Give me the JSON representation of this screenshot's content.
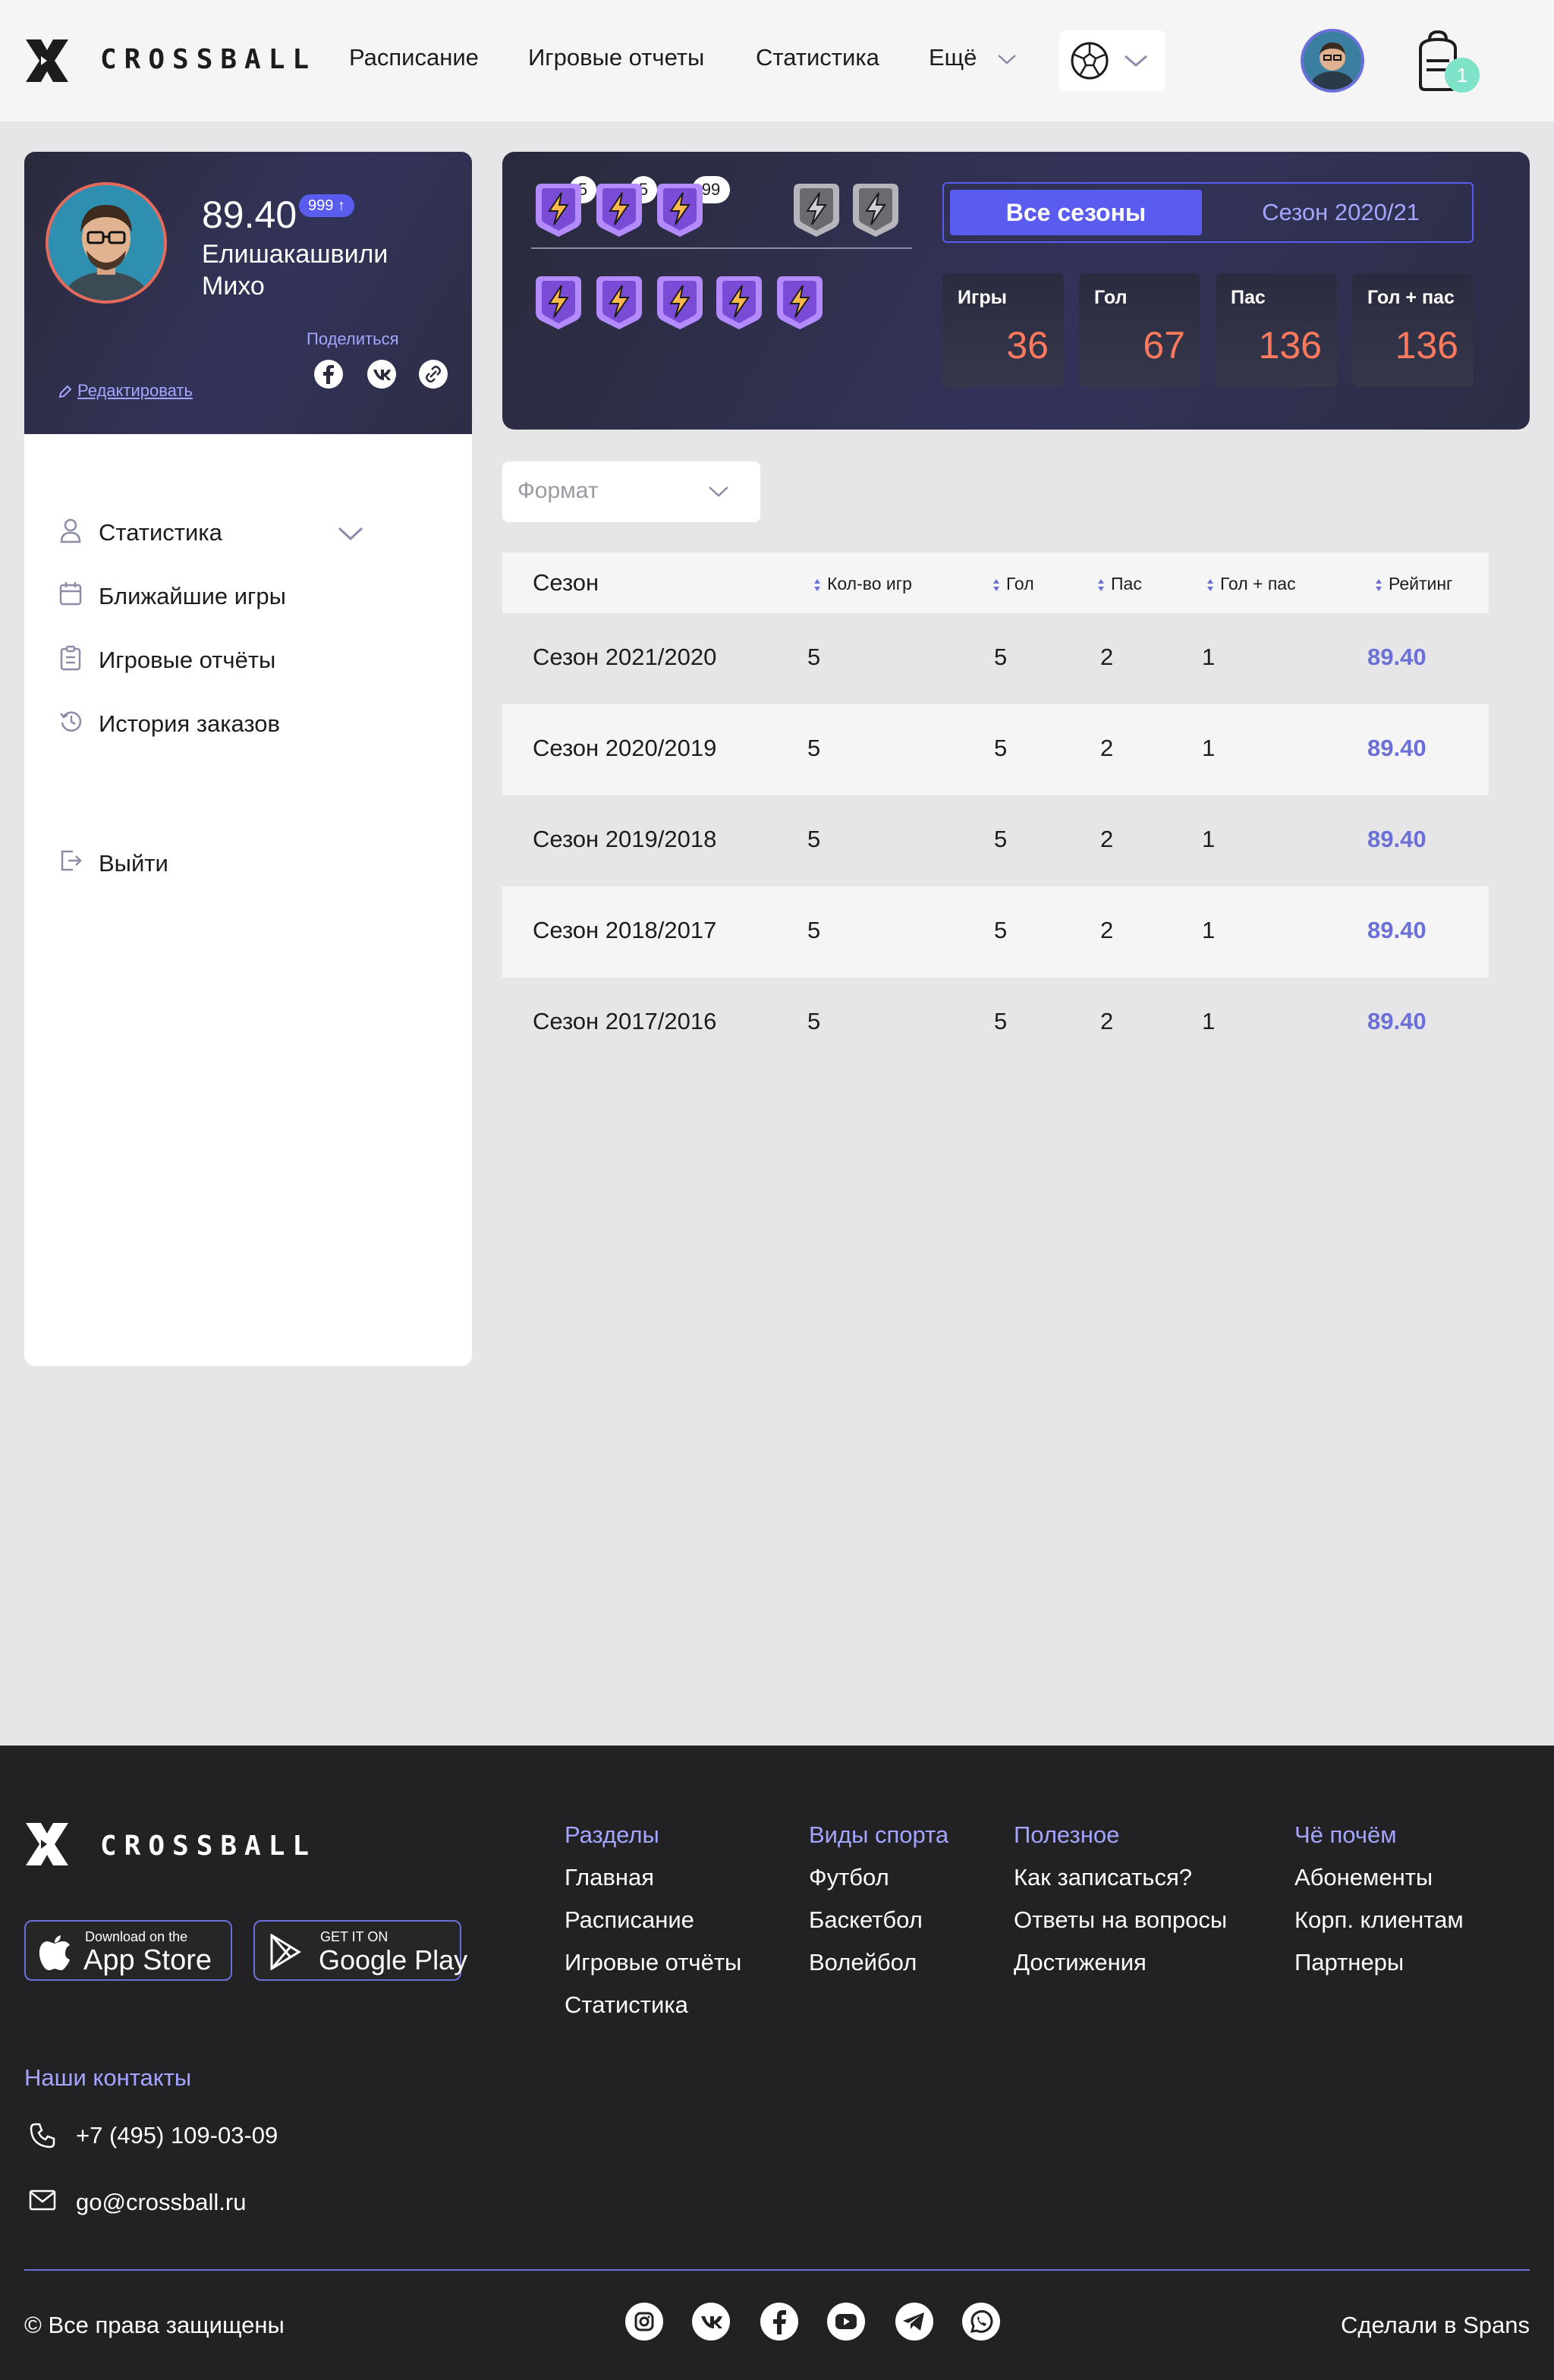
{
  "brand": {
    "name": "CROSSBALL"
  },
  "header": {
    "nav": [
      "Расписание",
      "Игровые отчеты",
      "Статистика",
      "Ещё"
    ],
    "cart_count": "1",
    "sport_icon": "soccer-ball-icon"
  },
  "profile": {
    "rating": "89.40",
    "rating_badge": "999 ↑",
    "name": "Елишакашвили Михо",
    "share_label": "Поделиться",
    "edit_label": "Редактировать"
  },
  "sidebar": {
    "items": [
      {
        "label": "Статистика",
        "icon": "user-icon"
      },
      {
        "label": "Ближайшие игры",
        "icon": "calendar-icon"
      },
      {
        "label": "Игровые отчёты",
        "icon": "clipboard-icon"
      },
      {
        "label": "История заказов",
        "icon": "history-icon"
      }
    ],
    "logout": "Выйти"
  },
  "achievements": {
    "top_counts": [
      "5",
      "5",
      "99"
    ]
  },
  "season_toggle": {
    "all": "Все сезоны",
    "current": "Сезон 2020/21"
  },
  "stats": [
    {
      "label": "Игры",
      "value": "36"
    },
    {
      "label": "Гол",
      "value": "67"
    },
    {
      "label": "Пас",
      "value": "136"
    },
    {
      "label": "Гол + пас",
      "value": "136"
    }
  ],
  "format_placeholder": "Формат",
  "table": {
    "headers": [
      "Сезон",
      "Кол-во игр",
      "Гол",
      "Пас",
      "Гол + пас",
      "Рейтинг"
    ],
    "rows": [
      [
        "Сезон 2021/2020",
        "5",
        "5",
        "2",
        "1",
        "89.40"
      ],
      [
        "Сезон 2020/2019",
        "5",
        "5",
        "2",
        "1",
        "89.40"
      ],
      [
        "Сезон 2019/2018",
        "5",
        "5",
        "2",
        "1",
        "89.40"
      ],
      [
        "Сезон 2018/2017",
        "5",
        "5",
        "2",
        "1",
        "89.40"
      ],
      [
        "Сезон 2017/2016",
        "5",
        "5",
        "2",
        "1",
        "89.40"
      ]
    ]
  },
  "footer": {
    "app_store": {
      "small": "Download on the",
      "big": "App Store"
    },
    "google_play": {
      "small": "GET IT ON",
      "big": "Google Play"
    },
    "columns": [
      {
        "title": "Разделы",
        "links": [
          "Главная",
          "Расписание",
          "Игровые отчёты",
          "Статистика"
        ]
      },
      {
        "title": "Виды спорта",
        "links": [
          "Футбол",
          "Баскетбол",
          "Волейбол"
        ]
      },
      {
        "title": "Полезное",
        "links": [
          "Как записаться?",
          "Ответы на вопросы",
          "Достижения"
        ]
      },
      {
        "title": "Чё почём",
        "links": [
          "Абонементы",
          "Корп. клиентам",
          "Партнеры"
        ]
      }
    ],
    "contacts_title": "Наши контакты",
    "phone": "+7 (495) 109-03-09",
    "email": "go@crossball.ru",
    "copyright": "© Все права защищены",
    "made_by": "Сделали в Spans"
  },
  "colors": {
    "accent": "#5a5cf0",
    "accent_light": "#a3a5ff",
    "stat_value": "#ff7a5c",
    "footer_bg": "#222224"
  }
}
